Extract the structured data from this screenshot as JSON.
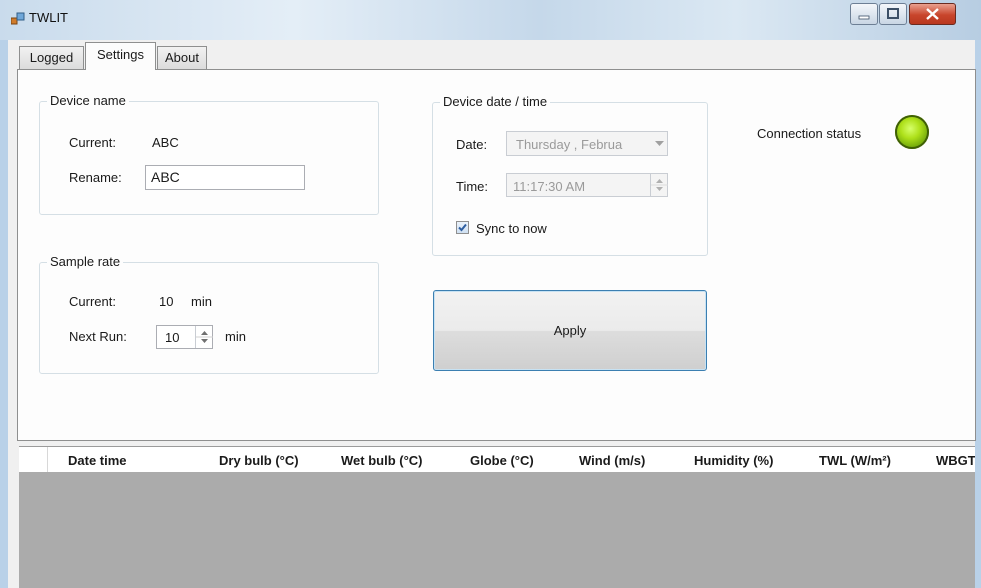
{
  "window": {
    "title": "TWLIT",
    "icon": "app-icon",
    "caption_buttons": [
      "minimize-icon",
      "maximize-icon",
      "close-icon"
    ]
  },
  "tabs": [
    {
      "label": "Logged",
      "active": false
    },
    {
      "label": "Settings",
      "active": true
    },
    {
      "label": "About",
      "active": false
    }
  ],
  "device_name": {
    "legend": "Device name",
    "current_label": "Current:",
    "current_value": "ABC",
    "rename_label": "Rename:",
    "rename_value": "ABC"
  },
  "sample_rate": {
    "legend": "Sample rate",
    "current_label": "Current:",
    "current_value": "10",
    "current_unit": "min",
    "next_run_label": "Next Run:",
    "next_run_value": "10",
    "next_run_unit": "min"
  },
  "device_datetime": {
    "legend": "Device date / time",
    "date_label": "Date:",
    "date_value": "Thursday , Februa",
    "time_label": "Time:",
    "time_value": "11:17:30 AM",
    "sync_label": "Sync to now",
    "sync_checked": true
  },
  "apply_label": "Apply",
  "connection": {
    "label": "Connection status",
    "status_color": "#9fd615"
  },
  "grid": {
    "columns": [
      "Date time",
      "Dry bulb (°C)",
      "Wet bulb (°C)",
      "Globe (°C)",
      "Wind (m/s)",
      "Humidity (%)",
      "TWL (W/m²)",
      "WBGT"
    ]
  }
}
